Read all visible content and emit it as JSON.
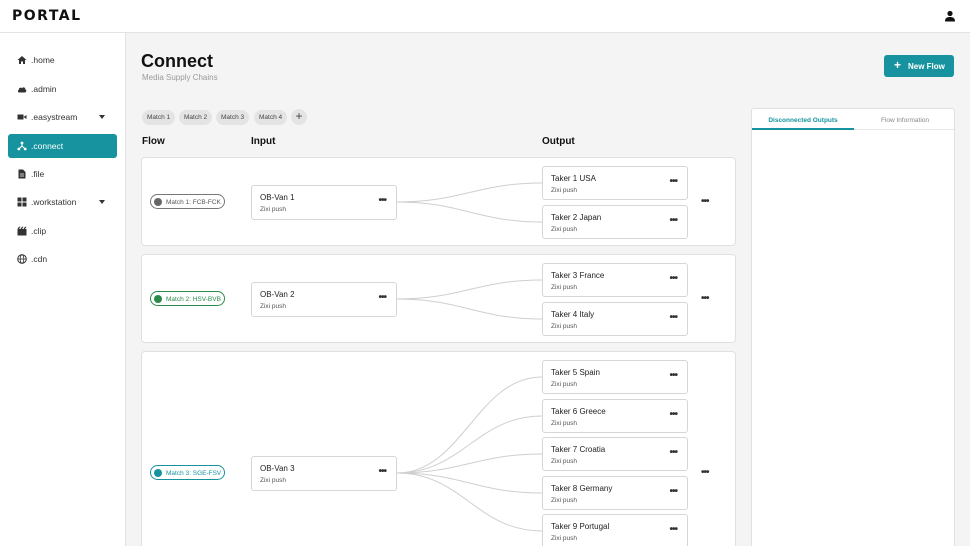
{
  "app": {
    "logo": "PORTAL"
  },
  "sidebar": {
    "items": [
      {
        "label": ".home",
        "icon": "home-icon"
      },
      {
        "label": ".admin",
        "icon": "cloud-icon"
      },
      {
        "label": ".easystream",
        "icon": "camera-icon",
        "has_dropdown": true
      },
      {
        "label": ".connect",
        "icon": "connect-icon",
        "active": true
      },
      {
        "label": ".file",
        "icon": "file-icon"
      },
      {
        "label": ".workstation",
        "icon": "grid-icon",
        "has_dropdown": true
      },
      {
        "label": ".clip",
        "icon": "clapperboard-icon"
      },
      {
        "label": ".cdn",
        "icon": "globe-icon"
      }
    ]
  },
  "page": {
    "title": "Connect",
    "subtitle": "Media Supply Chains",
    "new_flow_label": "New Flow",
    "chips": [
      "Match 1",
      "Match 2",
      "Match 3",
      "Match 4"
    ],
    "columns": {
      "flow": "Flow",
      "input": "Input",
      "output": "Output"
    }
  },
  "flows": [
    {
      "name": "Match 1: FCB-FCK",
      "status": "grey",
      "input": {
        "name": "OB-Van 1",
        "protocol": "Zixi push"
      },
      "outputs": [
        {
          "name": "Taker 1 USA",
          "protocol": "Zixi push"
        },
        {
          "name": "Taker 2 Japan",
          "protocol": "Zixi push"
        }
      ]
    },
    {
      "name": "Match 2: HSV-BVB",
      "status": "green",
      "input": {
        "name": "OB-Van 2",
        "protocol": "Zixi push"
      },
      "outputs": [
        {
          "name": "Taker 3 France",
          "protocol": "Zixi push"
        },
        {
          "name": "Taker 4 Italy",
          "protocol": "Zixi push"
        }
      ]
    },
    {
      "name": "Match 3: SGE-FSV",
      "status": "teal",
      "input": {
        "name": "OB-Van 3",
        "protocol": "Zixi push"
      },
      "outputs": [
        {
          "name": "Taker 5 Spain",
          "protocol": "Zixi push"
        },
        {
          "name": "Taker 6 Greece",
          "protocol": "Zixi push"
        },
        {
          "name": "Taker 7 Croatia",
          "protocol": "Zixi push"
        },
        {
          "name": "Taker 8 Germany",
          "protocol": "Zixi push"
        },
        {
          "name": "Taker 9 Portugal",
          "protocol": "Zixi push"
        }
      ]
    }
  ],
  "panel": {
    "tabs": [
      "Disconnected Outputs",
      "Flow Information"
    ],
    "active_tab": "Disconnected Outputs"
  },
  "colors": {
    "accent": "#16939e",
    "live_green": "#2a8a4a",
    "idle_grey": "#666666"
  }
}
